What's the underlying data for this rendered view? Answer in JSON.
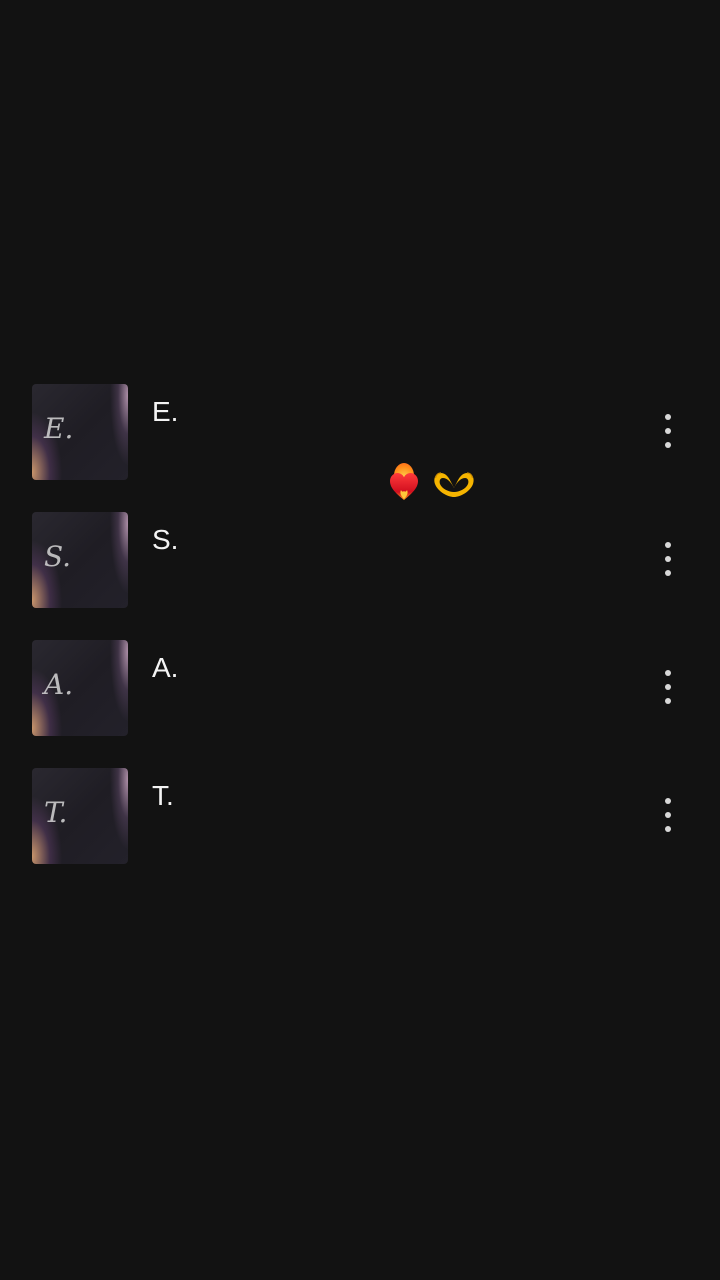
{
  "contacts": [
    {
      "thumb_letter": "E.",
      "name": "E."
    },
    {
      "thumb_letter": "S.",
      "name": "S."
    },
    {
      "thumb_letter": "A.",
      "name": "A."
    },
    {
      "thumb_letter": "T.",
      "name": "T."
    }
  ],
  "overlay": {
    "emojis": [
      "heart-on-fire-icon",
      "heart-hands-icon"
    ]
  },
  "colors": {
    "background": "#121212",
    "text": "#f4f4f4",
    "menu_dots": "#d8d8d8"
  }
}
